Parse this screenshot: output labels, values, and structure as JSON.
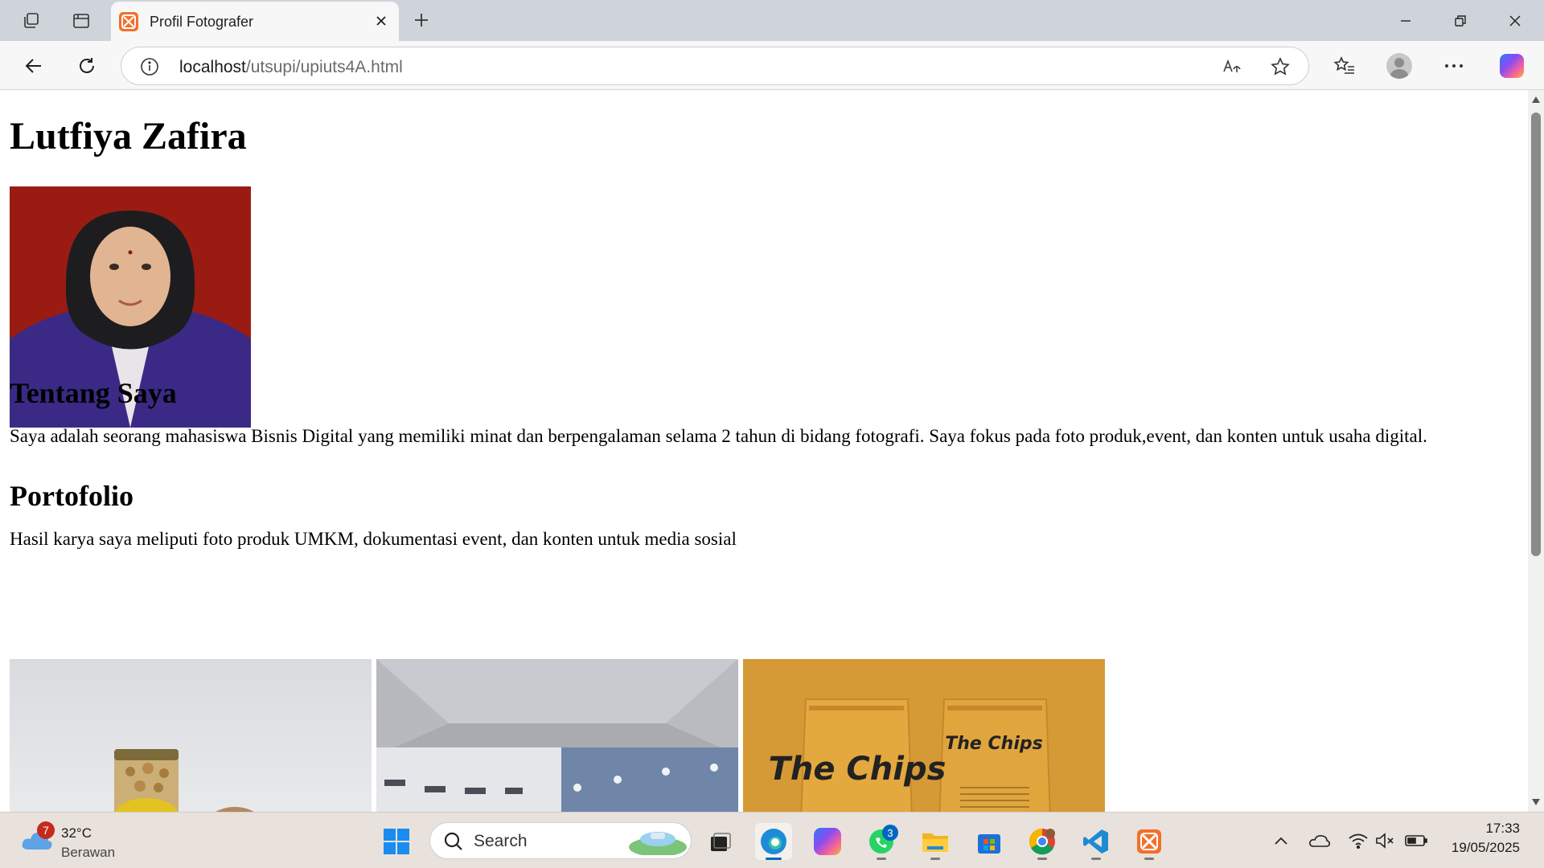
{
  "browser": {
    "tab_title": "Profil Fotografer",
    "url_host": "localhost",
    "url_path": "/utsupi/upiuts4A.html"
  },
  "page": {
    "name": "Lutfiya Zafira",
    "about_heading": "Tentang Saya",
    "about_text": "Saya adalah seorang mahasiswa Bisnis Digital yang memiliki minat dan berpengalaman selama 2 tahun di bidang fotografi. Saya fokus pada foto produk,event, dan konten untuk usaha digital.",
    "portfolio_heading": "Portofolio",
    "portfolio_text": "Hasil karya saya meliputi foto produk UMKM, dokumentasi event, dan konten untuk media sosial",
    "gallery": [
      {
        "name": "portfolio-product-jar-photo"
      },
      {
        "name": "portfolio-event-hall-photo"
      },
      {
        "name": "portfolio-chips-packaging-photo",
        "label": "The Chips"
      }
    ]
  },
  "taskbar": {
    "weather_temp": "32°C",
    "weather_desc": "Berawan",
    "weather_badge": "7",
    "search_label": "Search",
    "whatsapp_badge": "3",
    "time": "17:33",
    "date": "19/05/2025"
  },
  "colors": {
    "accent": "#0067c0",
    "photo_background": "#9a1b12",
    "chips_background": "#d59a35"
  }
}
